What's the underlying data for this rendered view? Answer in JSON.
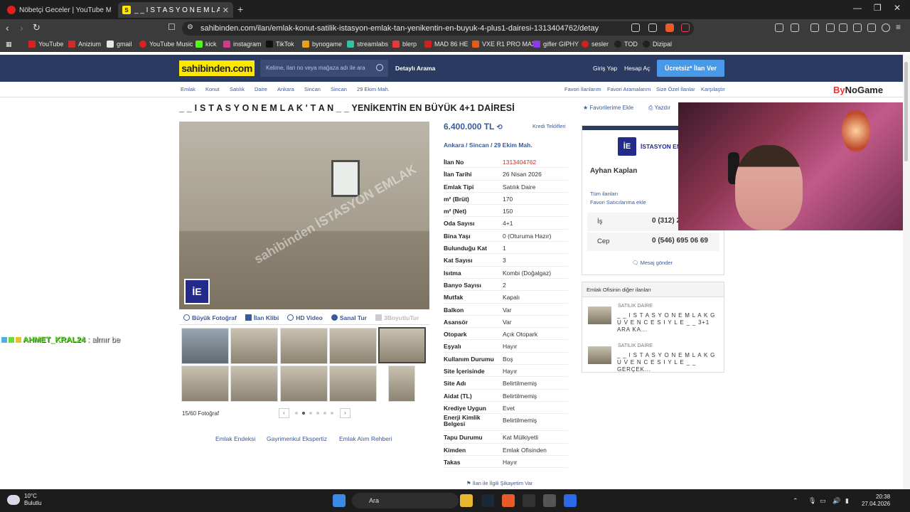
{
  "browser": {
    "tabs": [
      {
        "title": "Nöbetçi Geceler | YouTube Music",
        "favicon_color": "#e02020"
      },
      {
        "title": "_ _ I S T A S Y O N  E M L A K",
        "favicon_label": "S",
        "favicon_color": "#ffe800"
      }
    ],
    "url": "sahibinden.com/ilan/emlak-konut-satilik-istasyon-emlak-tan-yenikentin-en-buyuk-4-plus1-dairesi-1313404762/detay",
    "bookmarks": [
      {
        "label": "YouTube",
        "color": "#e02020"
      },
      {
        "label": "Anizium",
        "color": "#d12b2b"
      },
      {
        "label": "gmail",
        "color": "#e8e8e8"
      },
      {
        "label": "YouTube Music",
        "color": "#e02020"
      },
      {
        "label": "kick",
        "color": "#53fc18"
      },
      {
        "label": "instagram",
        "color": "#d13a8a"
      },
      {
        "label": "TikTok",
        "color": "#111111"
      },
      {
        "label": "bynogame",
        "color": "#e6a020"
      },
      {
        "label": "streamlabs",
        "color": "#31c3a2"
      },
      {
        "label": "blerp",
        "color": "#e63a3a"
      },
      {
        "label": "MAD 86 HE",
        "color": "#d12020"
      },
      {
        "label": "VXE R1 PRO MAX",
        "color": "#e65a1a"
      },
      {
        "label": "gifler GIPHY",
        "color": "#8a3ae6"
      },
      {
        "label": "sesler",
        "color": "#d02020"
      },
      {
        "label": "TOD",
        "color": "#202020"
      },
      {
        "label": "Dizipal",
        "color": "#202020"
      }
    ]
  },
  "site": {
    "logo": "sahibinden.com",
    "search_placeholder": "Kelime, ilan no veya mağaza adı ile ara",
    "detailed_search": "Detaylı Arama",
    "login": "Giriş Yap",
    "register": "Hesap Aç",
    "post_ad": "Ücretsiz* İlan Ver"
  },
  "breadcrumbs": [
    "Emlak",
    "Konut",
    "Satılık",
    "Daire",
    "Ankara",
    "Sincan",
    "Sincan",
    "29 Ekim Mah."
  ],
  "right_links": [
    "Favori İlanlarım",
    "Favori Aramalarım",
    "Size Özel İlanlar",
    "Karşılaştır"
  ],
  "bynogame": {
    "part1": "By",
    "part2": "NoGame"
  },
  "listing": {
    "title": "_ _ I S T A S Y O N  E M L A K ' T A N _ _  YENİKENTİN EN BÜYÜK 4+1 DAİRESİ",
    "favorite": "Favorilerime Ekle",
    "print": "Yazdır",
    "watermark": "sahibinden İSTASYON EMLAK",
    "media_tabs": [
      "Büyük Fotoğraf",
      "İlan Klibi",
      "HD Video",
      "Sanal Tur",
      "3BoyutluTur"
    ],
    "photo_count": "15/60 Fotoğraf",
    "price": "6.400.000 TL",
    "credit": "Kredi Teklifleri",
    "location": "Ankara  /  Sincan  /  29 Ekim Mah.",
    "details": [
      {
        "k": "İlan No",
        "v": "1313404762",
        "highlight": true
      },
      {
        "k": "İlan Tarihi",
        "v": "26 Nisan 2026"
      },
      {
        "k": "Emlak Tipi",
        "v": "Satılık Daire"
      },
      {
        "k": "m² (Brüt)",
        "v": "170"
      },
      {
        "k": "m² (Net)",
        "v": "150"
      },
      {
        "k": "Oda Sayısı",
        "v": "4+1"
      },
      {
        "k": "Bina Yaşı",
        "v": "0 (Oturuma Hazır)"
      },
      {
        "k": "Bulunduğu Kat",
        "v": "1"
      },
      {
        "k": "Kat Sayısı",
        "v": "3"
      },
      {
        "k": "Isıtma",
        "v": "Kombi (Doğalgaz)"
      },
      {
        "k": "Banyo Sayısı",
        "v": "2"
      },
      {
        "k": "Mutfak",
        "v": "Kapalı"
      },
      {
        "k": "Balkon",
        "v": "Var"
      },
      {
        "k": "Asansör",
        "v": "Var"
      },
      {
        "k": "Otopark",
        "v": "Açık Otopark"
      },
      {
        "k": "Eşyalı",
        "v": "Hayır"
      },
      {
        "k": "Kullanım Durumu",
        "v": "Boş"
      },
      {
        "k": "Site İçerisinde",
        "v": "Hayır"
      },
      {
        "k": "Site Adı",
        "v": "Belirtilmemiş"
      },
      {
        "k": "Aidat (TL)",
        "v": "Belirtilmemiş"
      },
      {
        "k": "Krediye Uygun",
        "v": "Evet"
      },
      {
        "k": "Enerji Kimlik Belgesi",
        "v": "Belirtilmemiş"
      },
      {
        "k": "Tapu Durumu",
        "v": "Kat Mülkiyetli"
      },
      {
        "k": "Kimden",
        "v": "Emlak Ofisinden"
      },
      {
        "k": "Takas",
        "v": "Hayır"
      }
    ],
    "complaint": "İlan ile İlgili Şikayetim Var",
    "footer_links": [
      "Emlak Endeksi",
      "Gayrimenkul Ekspertiz",
      "Emlak Alım Rehberi"
    ]
  },
  "seller": {
    "office": "İSTASYON EMLAK",
    "logo_letters": "İE",
    "name": "Ayhan Kaplan",
    "all_ads": "Tüm ilanları",
    "add_fav": "Favori Satıcılarıma ekle",
    "phones": [
      {
        "k": "İş",
        "v": "0 (312) 2"
      },
      {
        "k": "Cep",
        "v": "0 (546) 695 06 69"
      }
    ],
    "message": "Mesaj gönder"
  },
  "other_ads": {
    "header": "Emlak Ofisinin diğer ilanları",
    "items": [
      {
        "type": "SATILIK DAİRE",
        "title": "_ _ I S T A S Y O N  E M L A K  G U V E N C E S I Y L E _ _ 3+1 ARA KA..."
      },
      {
        "type": "SATILIK DAİRE",
        "title": "_ _ I S T A S Y O N  E M L A K  G U V E N C E S I Y L E _ _  GERÇEK..."
      }
    ]
  },
  "chat": {
    "user": "AHMET_KRAL24",
    "message": ": almır be"
  },
  "taskbar": {
    "temp": "10°C",
    "weather": "Bulutlu",
    "search": "Ara",
    "time": "20:38",
    "date": "27.04.2026"
  }
}
